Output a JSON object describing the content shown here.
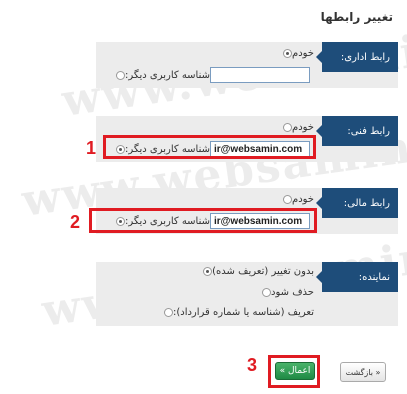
{
  "page": {
    "title": "تغییر رابطها"
  },
  "watermark": {
    "text": "www.websamin.com"
  },
  "sections": [
    {
      "label": "رابط اداری:",
      "options": [
        {
          "label": "خودم",
          "checked": true
        },
        {
          "label": "شناسه کاربری دیگر:",
          "checked": false,
          "value": ""
        }
      ]
    },
    {
      "label": "رابط فنی:",
      "options": [
        {
          "label": "خودم",
          "checked": false
        },
        {
          "label": "شناسه کاربری دیگر:",
          "checked": true,
          "value": "ir@websamin.com"
        }
      ]
    },
    {
      "label": "رابط مالی:",
      "options": [
        {
          "label": "خودم",
          "checked": false
        },
        {
          "label": "شناسه کاربری دیگر:",
          "checked": true,
          "value": "ir@websamin.com"
        }
      ]
    },
    {
      "label": "نماینده:",
      "options": [
        {
          "label": "بدون تغییر (تعریف شده)",
          "checked": true
        },
        {
          "label": "حذف شود",
          "checked": false
        },
        {
          "label": "تعریف (شناسه یا شماره قرارداد):",
          "checked": false
        }
      ]
    }
  ],
  "callouts": [
    "1",
    "2",
    "3"
  ],
  "buttons": {
    "apply": "اعمال »",
    "back": "« بازگشت"
  },
  "colors": {
    "label_bg": "#1e4d7a",
    "callout": "#e01b22",
    "apply_bg": "#2e9a50"
  }
}
